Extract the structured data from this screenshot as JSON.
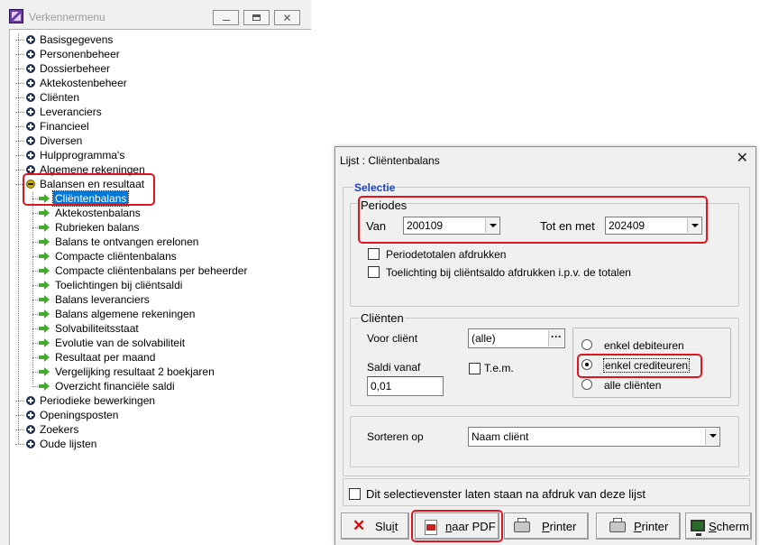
{
  "menu_window": {
    "title": "Verkennermenu",
    "tree": [
      {
        "label": "Basisgegevens"
      },
      {
        "label": "Personenbeheer"
      },
      {
        "label": "Dossierbeheer"
      },
      {
        "label": "Aktekostenbeheer"
      },
      {
        "label": "Cliënten"
      },
      {
        "label": "Leveranciers"
      },
      {
        "label": "Financieel"
      },
      {
        "label": "Diversen"
      },
      {
        "label": "Hulpprogramma's"
      },
      {
        "label": "Algemene rekeningen"
      },
      {
        "label": "Balansen en resultaat",
        "expanded": true,
        "children": [
          "Cliëntenbalans",
          "Aktekostenbalans",
          "Rubrieken balans",
          "Balans te ontvangen erelonen",
          "Compacte cliëntenbalans",
          "Compacte cliëntenbalans per beheerder",
          "Toelichtingen bij cliëntsaldi",
          "Balans leveranciers",
          "Balans algemene rekeningen",
          "Solvabiliteitsstaat",
          "Evolutie van de solvabiliteit",
          "Resultaat per maand",
          "Vergelijking resultaat 2 boekjaren",
          "Overzicht financiële saldi"
        ]
      },
      {
        "label": "Periodieke bewerkingen"
      },
      {
        "label": "Openingsposten"
      },
      {
        "label": "Zoekers"
      },
      {
        "label": "Oude lijsten"
      }
    ],
    "selected_item": "Cliëntenbalans"
  },
  "dialog": {
    "title": "Lijst : Cliëntenbalans",
    "close_glyph": "✕",
    "selectie_label": "Selectie",
    "periodes": {
      "group_label": "Periodes",
      "van_label": "Van",
      "van_value": "200109",
      "tot_label": "Tot en met",
      "tot_value": "202409",
      "checkbox_periodetotalen": "Periodetotalen afdrukken",
      "checkbox_toelichting": "Toelichting bij cliëntsaldo afdrukken i.p.v. de totalen"
    },
    "clienten": {
      "group_label": "Cliënten",
      "voor_client_label": "Voor cliënt",
      "voor_client_value": "(alle)",
      "browse_glyph": "···",
      "saldi_vanaf_label": "Saldi vanaf",
      "saldi_vanaf_value": "0,01",
      "tem_label": "T.e.m.",
      "radio_options": [
        "enkel debiteuren",
        "enkel crediteuren",
        "alle cliënten"
      ],
      "radio_selected": "enkel crediteuren"
    },
    "sorteren": {
      "label": "Sorteren op",
      "value": "Naam cliënt"
    },
    "keep_open_checkbox": "Dit selectievenster laten staan na afdruk van deze lijst",
    "buttons": {
      "sluit_pre": "Slu",
      "sluit_u": "i",
      "sluit_post": "t",
      "pdf_pre": "",
      "pdf_u": "n",
      "pdf_post": "aar PDF",
      "printer1_pre": "",
      "printer1_u": "P",
      "printer1_post": "rinter",
      "printer2_pre": "",
      "printer2_u": "P",
      "printer2_post": "rinter",
      "scherm_pre": "",
      "scherm_u": "S",
      "scherm_post": "cherm"
    }
  },
  "colors": {
    "selection_blue": "#0078d7",
    "highlight_red": "#e0141e",
    "selectie_blue": "#1c3fc4",
    "arrow_green": "#3fae2a"
  }
}
